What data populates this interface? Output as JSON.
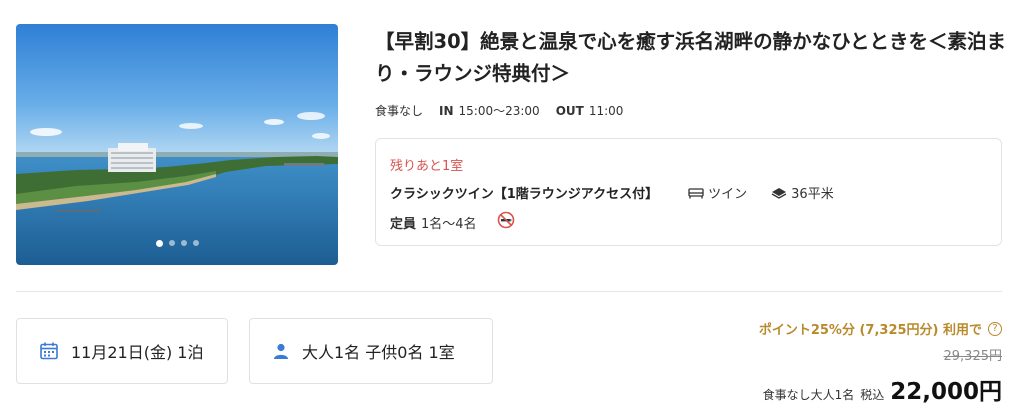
{
  "plan": {
    "title": "【早割30】絶景と温泉で心を癒す浜名湖畔の静かなひとときを＜素泊まり・ラウンジ特典付＞",
    "meal": "食事なし",
    "checkin_label": "IN",
    "checkin_value": "15:00〜23:00",
    "checkout_label": "OUT",
    "checkout_value": "11:00"
  },
  "gallery": {
    "image_description": "Lakeside hotel on Lake Hamana under blue sky",
    "slide_count": 4,
    "active_slide": 1
  },
  "room": {
    "availability": "残りあと1室",
    "name": "クラシックツイン【1階ラウンジアクセス付】",
    "bed_type": "ツイン",
    "area": "36平米",
    "capacity_label": "定員",
    "capacity_value": "1名〜4名",
    "smoking_icon": "no-smoking-icon"
  },
  "search": {
    "date": "11月21日(金) 1泊",
    "guests": "大人1名 子供0名 1室"
  },
  "price": {
    "points_text": "ポイント25%分 (7,325円分) 利用で",
    "help_glyph": "?",
    "original": "29,325円",
    "note": "食事なし大人1名",
    "tax_label": "税込",
    "amount": "22,000円"
  },
  "colors": {
    "accent_gold": "#b88a2c",
    "alert_red": "#d9534f",
    "icon_blue": "#3a7bd5"
  }
}
